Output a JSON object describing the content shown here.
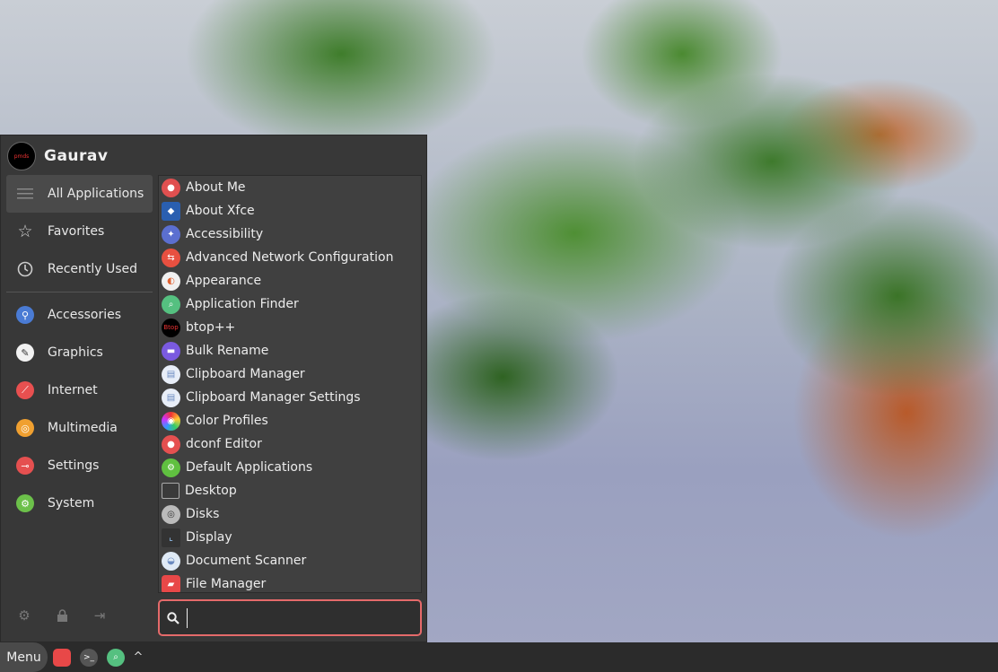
{
  "user": {
    "name": "Gaurav",
    "avatar_text": "pmds"
  },
  "categories": [
    {
      "label": "All Applications",
      "icon": "list-icon",
      "active": true
    },
    {
      "label": "Favorites",
      "icon": "star-icon"
    },
    {
      "label": "Recently Used",
      "icon": "history-icon"
    },
    {
      "label": "Accessories",
      "icon": "accessories-icon",
      "color": "#4a7bd4"
    },
    {
      "label": "Graphics",
      "icon": "graphics-icon",
      "color": "#f2f2f2"
    },
    {
      "label": "Internet",
      "icon": "internet-icon",
      "color": "#e85050"
    },
    {
      "label": "Multimedia",
      "icon": "multimedia-icon",
      "color": "#f0a030"
    },
    {
      "label": "Settings",
      "icon": "settings-icon",
      "color": "#e55050"
    },
    {
      "label": "System",
      "icon": "system-icon",
      "color": "#6cc04a"
    }
  ],
  "apps": [
    {
      "label": "About Me",
      "color": "#e05050",
      "glyph": "●"
    },
    {
      "label": "About Xfce",
      "color": "#2a5fb0",
      "glyph": "◆"
    },
    {
      "label": "Accessibility",
      "color": "#5b6fd0",
      "glyph": "♿"
    },
    {
      "label": "Advanced Network Configuration",
      "color": "#e85040",
      "glyph": "⇆"
    },
    {
      "label": "Appearance",
      "color": "#f0f0f0",
      "glyph": "◐"
    },
    {
      "label": "Application Finder",
      "color": "#55c080",
      "glyph": "⌕"
    },
    {
      "label": "btop++",
      "color": "#000000",
      "glyph": "B"
    },
    {
      "label": "Bulk Rename",
      "color": "#7a5ae0",
      "glyph": "▬"
    },
    {
      "label": "Clipboard Manager",
      "color": "#e8eef8",
      "glyph": "▤"
    },
    {
      "label": "Clipboard Manager Settings",
      "color": "#e8eef8",
      "glyph": "▤"
    },
    {
      "label": "Color Profiles",
      "color": "#d05aa0",
      "glyph": "◉"
    },
    {
      "label": "dconf Editor",
      "color": "#e55050",
      "glyph": "●"
    },
    {
      "label": "Default Applications",
      "color": "#60c040",
      "glyph": "⚙"
    },
    {
      "label": "Desktop",
      "color": "#3a3a3a",
      "glyph": "▭"
    },
    {
      "label": "Disks",
      "color": "#bbbbbb",
      "glyph": "◎"
    },
    {
      "label": "Display",
      "color": "#333333",
      "glyph": "L"
    },
    {
      "label": "Document Scanner",
      "color": "#dfeaf6",
      "glyph": "◒"
    },
    {
      "label": "File Manager",
      "color": "#e84848",
      "glyph": "▰"
    }
  ],
  "search": {
    "value": "",
    "placeholder": ""
  },
  "bottom_actions": [
    {
      "icon": "settings-gear-icon",
      "glyph": "⚙"
    },
    {
      "icon": "lock-icon",
      "glyph": "🔒"
    },
    {
      "icon": "logout-icon",
      "glyph": "⇥"
    }
  ],
  "panel": {
    "menu_label": "Menu",
    "tray": [
      {
        "icon": "file-manager-icon",
        "color": "#e84848"
      },
      {
        "icon": "terminal-icon",
        "color": "#555555"
      },
      {
        "icon": "app-finder-icon",
        "color": "#55c080"
      }
    ],
    "expand_glyph": "^"
  }
}
